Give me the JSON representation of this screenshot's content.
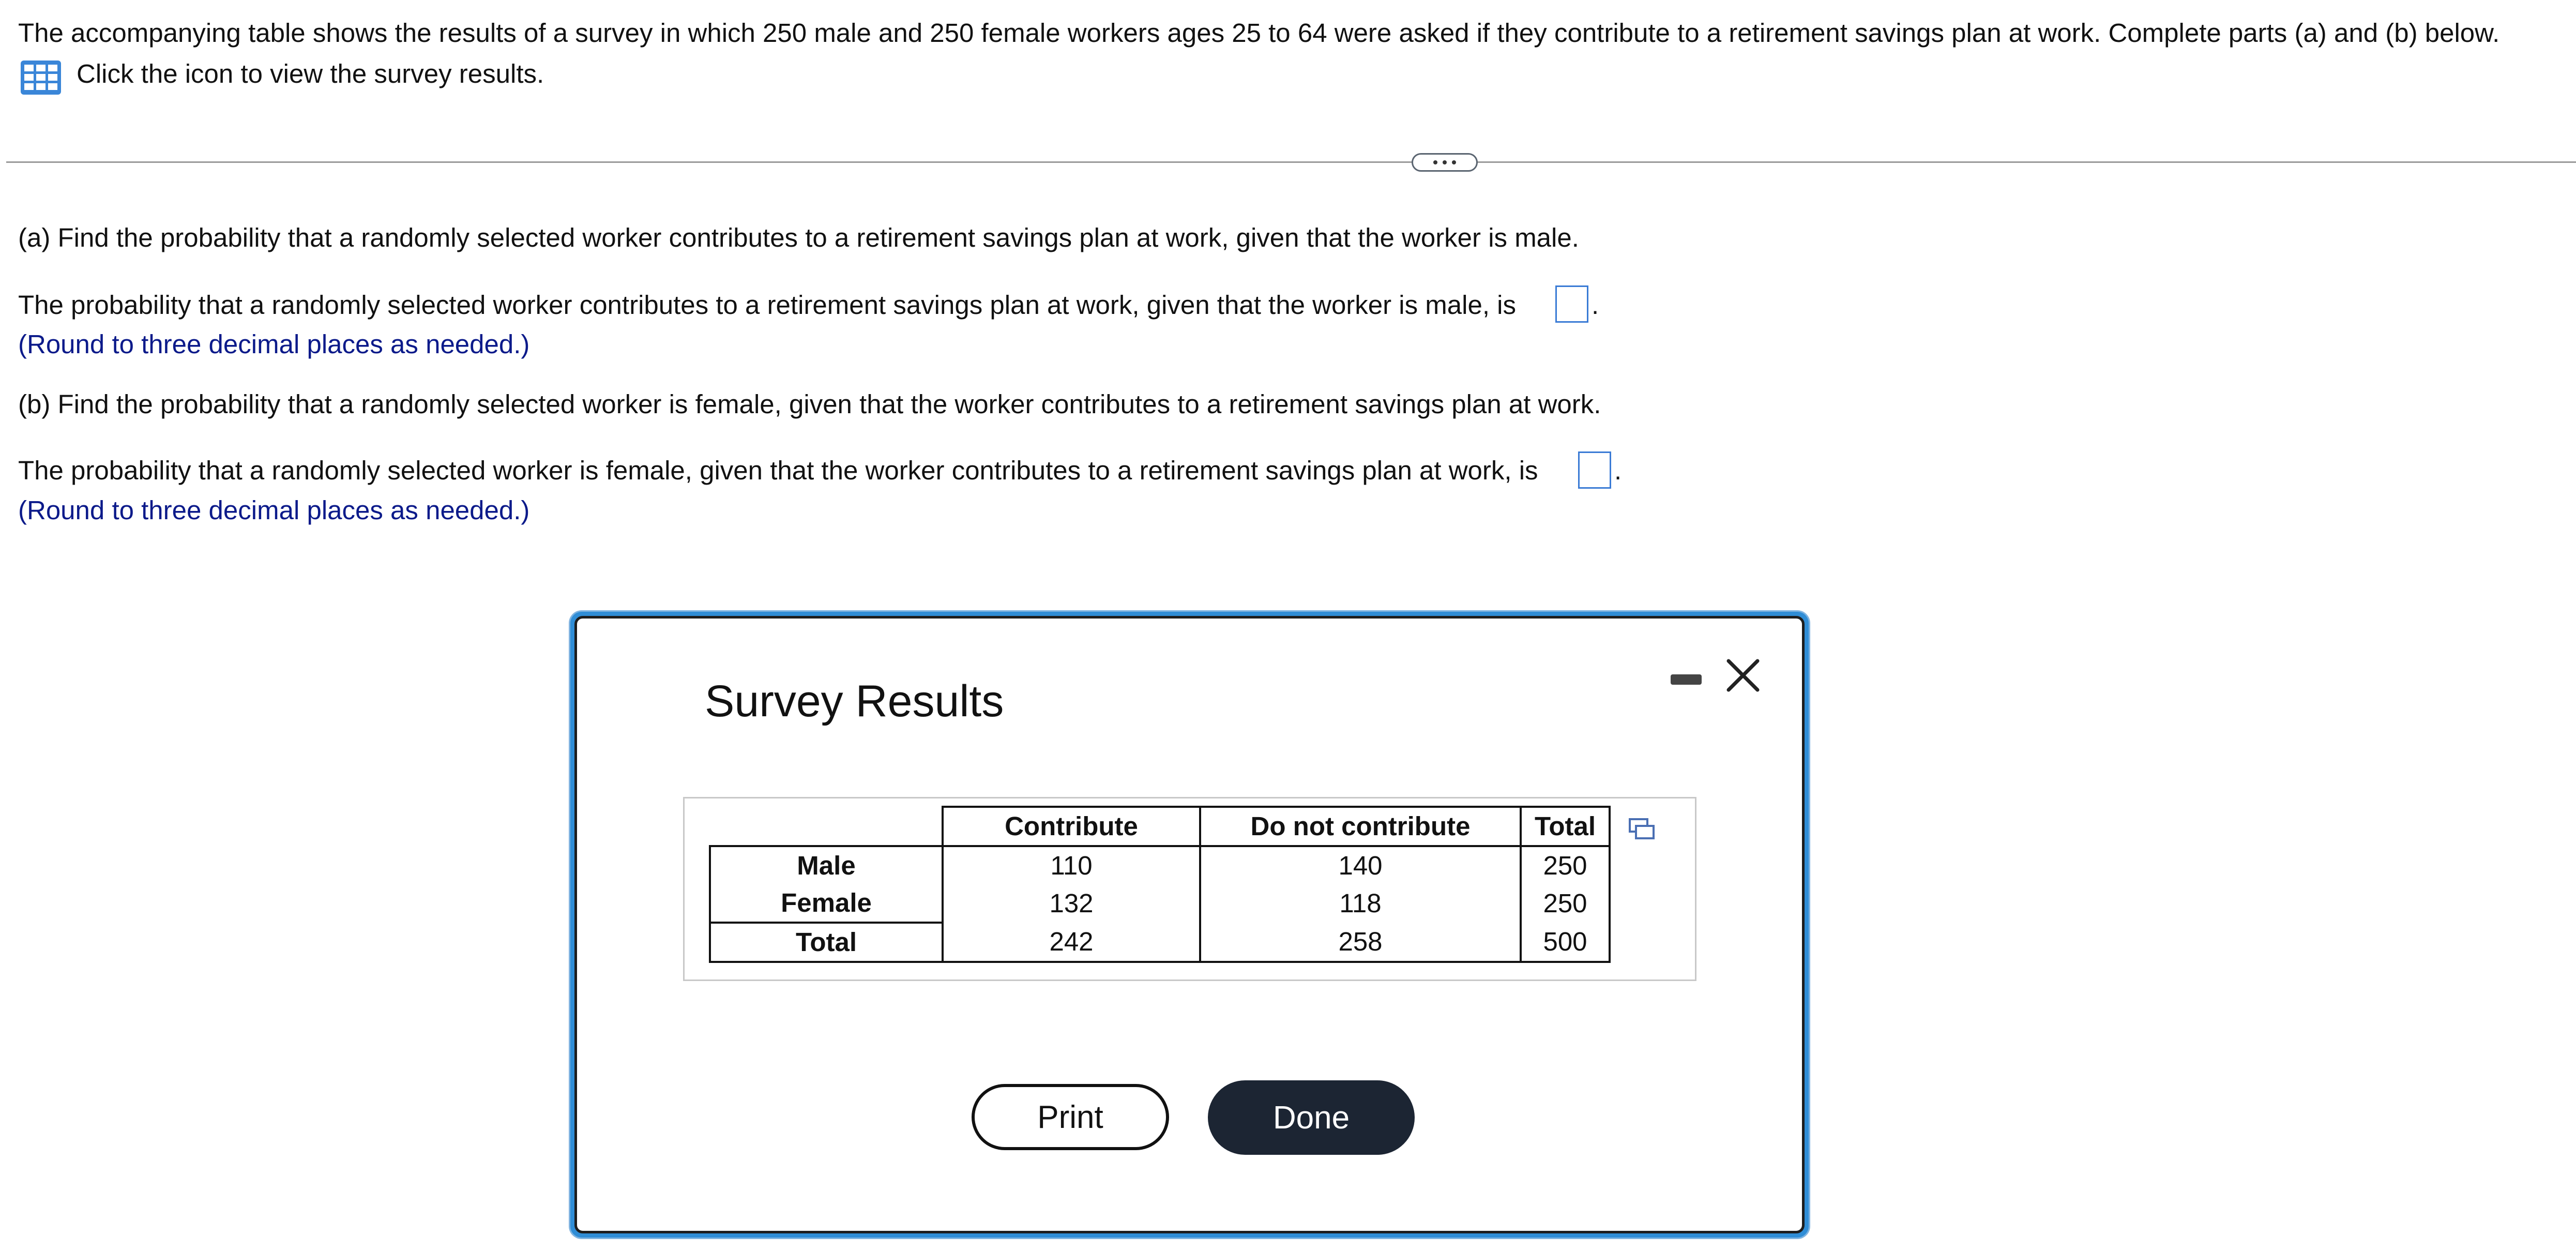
{
  "question": {
    "intro": "The accompanying table shows the results of a survey in which 250 male and 250 female workers ages 25 to 64 were asked if they contribute to a retirement savings plan at work. Complete parts (a) and (b) below.",
    "icon_prompt": "Click the icon to view the survey results.",
    "icon": "table-grid-icon"
  },
  "part_a": {
    "prompt": "(a) Find the probability that a randomly selected worker contributes to a retirement savings plan at work, given that the worker is male.",
    "answer_prefix": "The probability that a randomly selected worker contributes to a retirement savings plan at work, given that the worker is male, is",
    "answer_value": "",
    "answer_suffix": ".",
    "note": "(Round to three decimal places as needed.)"
  },
  "part_b": {
    "prompt": "(b) Find the probability that a randomly selected worker is female, given that the worker contributes to a retirement savings plan at work.",
    "answer_prefix": "The probability that a randomly selected worker is female, given that the worker contributes to a retirement savings plan at work, is",
    "answer_value": "",
    "answer_suffix": ".",
    "note": "(Round to three decimal places as needed.)"
  },
  "modal": {
    "title": "Survey Results",
    "table": {
      "headers": [
        "Contribute",
        "Do not contribute",
        "Total"
      ],
      "rows": [
        {
          "label": "Male",
          "values": [
            "110",
            "140",
            "250"
          ]
        },
        {
          "label": "Female",
          "values": [
            "132",
            "118",
            "250"
          ]
        },
        {
          "label": "Total",
          "values": [
            "242",
            "258",
            "500"
          ]
        }
      ]
    },
    "print_label": "Print",
    "done_label": "Done"
  },
  "colors": {
    "accent_blue": "#2f8dd6",
    "note_blue": "#0b1a8a",
    "done_button": "#1c2533"
  }
}
